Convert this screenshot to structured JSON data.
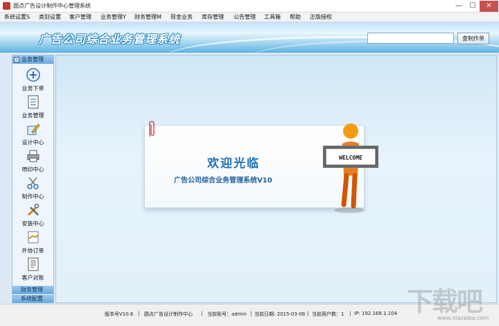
{
  "window": {
    "title": "圆点广告设计制作中心管理系统",
    "min": "—",
    "max": "☐",
    "close": "✕"
  },
  "menu": [
    "系统设置S",
    "类别设置",
    "客户管理",
    "业务管理Y",
    "财务管理M",
    "现金业务",
    "库存管理",
    "公告管理",
    "工具箱",
    "帮助",
    "正版授权"
  ],
  "banner": {
    "title": "广告公司综合业务管理系统",
    "search_value": "",
    "button": "查制作单"
  },
  "sidebar": {
    "header": "业务管理",
    "items": [
      {
        "label": "业务下单",
        "icon": "add-circle-icon"
      },
      {
        "label": "业务管理",
        "icon": "list-document-icon"
      },
      {
        "label": "设计中心",
        "icon": "design-pencil-icon"
      },
      {
        "label": "喷印中心",
        "icon": "printer-icon"
      },
      {
        "label": "制作中心",
        "icon": "scissors-icon"
      },
      {
        "label": "安装中心",
        "icon": "tools-icon"
      },
      {
        "label": "外协订单",
        "icon": "handshake-icon"
      },
      {
        "label": "客户对账",
        "icon": "ledger-document-icon"
      }
    ],
    "footer_sections": [
      "财务管理",
      "系统配置"
    ]
  },
  "welcome": {
    "title": "欢迎光临",
    "subtitle": "广告公司综合业务管理系统V10",
    "sign": "WELCOME"
  },
  "status": {
    "version": "版本号V10.6",
    "company": "圆点广告设计制作中心",
    "account": "当前账号：admin",
    "date": "当前日期: 2015-03-08",
    "users": "当前用户数：1",
    "ip": "IP: 192.168.1.104",
    "sep": "|"
  },
  "watermark": {
    "big": "下载吧",
    "small": "www.xiazaiba.com"
  }
}
